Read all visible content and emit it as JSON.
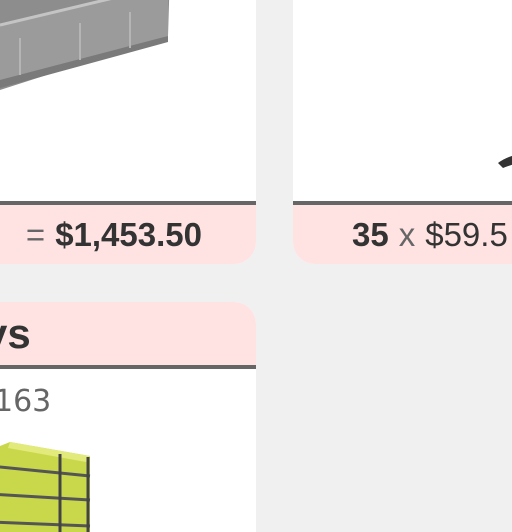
{
  "cards": [
    {
      "name": "tray-product",
      "icon": "gray-tray-image",
      "total": {
        "separator": "=",
        "amount": "$1,453.50"
      }
    },
    {
      "name": "bracket-product",
      "icon": "dark-bracket-image",
      "line": {
        "quantity": "35",
        "times": "x",
        "unit_price": "$59.5"
      }
    },
    {
      "name": "shelving-product",
      "icon": "yellow-shelving-image",
      "header_title": "ys",
      "meta": "163"
    }
  ],
  "colors": {
    "page_background": "#f0f0f0",
    "card_background": "#ffffff",
    "band_background": "#ffe3e3",
    "divider": "#666666",
    "text_dark": "#333333",
    "text_muted": "#666666"
  }
}
